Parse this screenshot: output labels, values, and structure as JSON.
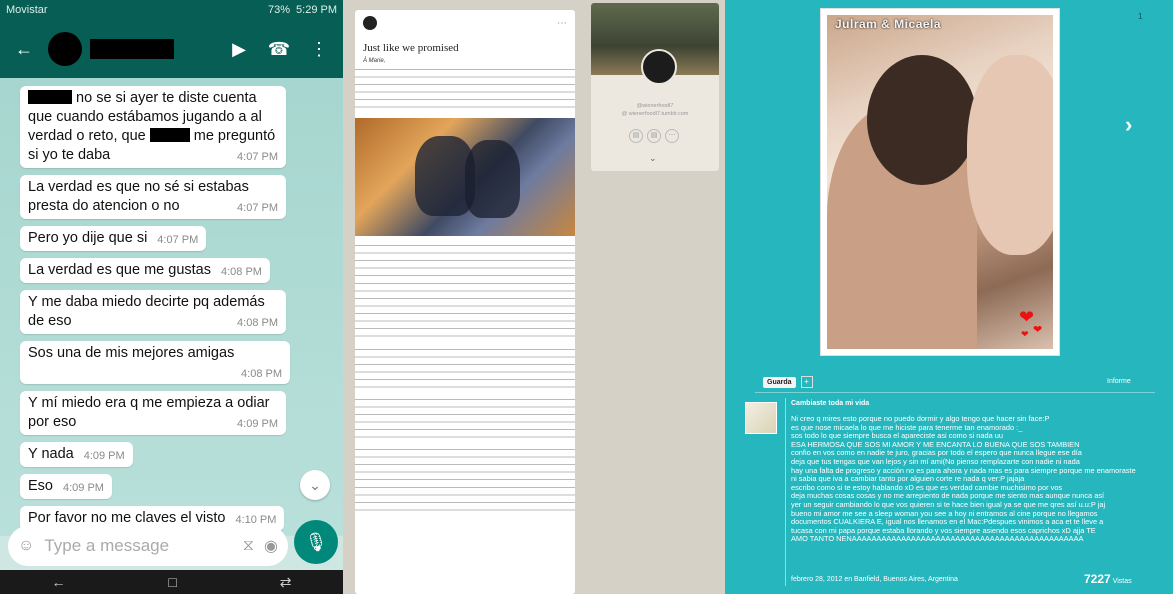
{
  "whatsapp": {
    "status": {
      "carrier": "Movistar",
      "battery": "73%",
      "time": "5:29 PM"
    },
    "messages": [
      {
        "pre": "",
        "text": "no se si ayer te diste cuenta que cuando estábamos jugando a al verdad o reto, que",
        "text2": "me preguntó si yo te daba",
        "time": "4:07 PM"
      },
      {
        "text": "La verdad es que no sé si estabas presta do atencion o no",
        "time": "4:07 PM"
      },
      {
        "text": "Pero yo dije que si",
        "time": "4:07 PM"
      },
      {
        "text": "La verdad es que me gustas",
        "time": "4:08 PM"
      },
      {
        "text": "Y me daba miedo decirte pq además de eso",
        "time": "4:08 PM"
      },
      {
        "text": "Sos una de mis mejores amigas",
        "time": "4:08 PM"
      },
      {
        "text": "Y mí miedo era q me empieza a odiar por eso",
        "time": "4:09 PM"
      },
      {
        "text": "Y nada",
        "time": "4:09 PM"
      },
      {
        "text": "Eso",
        "time": "4:09 PM"
      },
      {
        "text": "Por favor no me claves el visto",
        "time": "4:10 PM"
      }
    ],
    "composer_placeholder": "Type a message"
  },
  "tumblr": {
    "post_title": "Just like we promised",
    "greeting": "À Marie,",
    "side": {
      "handle": "@wienerfoodl7",
      "url": "@ wienerfoodl7.tumblr.com"
    }
  },
  "fotolog": {
    "caption": "Julram & Micaela",
    "page": "1",
    "guarda": "Guarda",
    "informe": "Informe",
    "post_title": "Cambiaste toda mi vida",
    "post_body": "Ni creo q mires esto porque no puedo dormir y algo tengo que hacer sin face:P\nes que nose micaela lo que me hiciste para tenerme tan enamorado :_\nsos todo lo que siempre busca el apareciste asi como si nada uu\nESA HERMOSA QUE SOS MI AMOR Y ME ENCANTA LO BUENA QUE SOS TAMBIEN\nconfio en vos como en nadie te juro, gracias por todo el espero que nunca llegue ese día\ndeja que tus tengas que van lejos y sin mí ami(No pienso remplazarte con nadie ni nada\nhay una falta de progreso y acción no es para ahora y nada mas es para siempre porque me enamoraste\nni sabia que iva a cambiar tanto por alguien corte re nada q ver:P jajaja\nescribo como si te estoy hablando xD es que es verdad cambie muchisimo por vos\ndeja muchas cosas cosas y no me arrepiento de nada porque me siento mas aunque nunca así\nyer un seguir cambiando lo que vos quieren si te hace bien igual ya se que me qres así u.u:P jaj\nbueno mi amor me see a sleep woman you see a hoy ni entramos al cine porque no llegamos\ndocumentos CUALKIERA E, igual nos llenamos en el Mac:Pdespues vinimos a aca et te lleve a\ntucasa con mi papa porque estaba llorando y vos siempre asiendo esos caprichos xD ajja TE\nAMO TANTO NENAAAAAAAAAAAAAAAAAAAAAAAAAAAAAAAAAAAAAAAAAAAAAAA",
    "meta": "febrero 28, 2012 en Banfield, Buenos Aires, Argentina",
    "views_count": "7227",
    "views_label": "Vistas"
  }
}
